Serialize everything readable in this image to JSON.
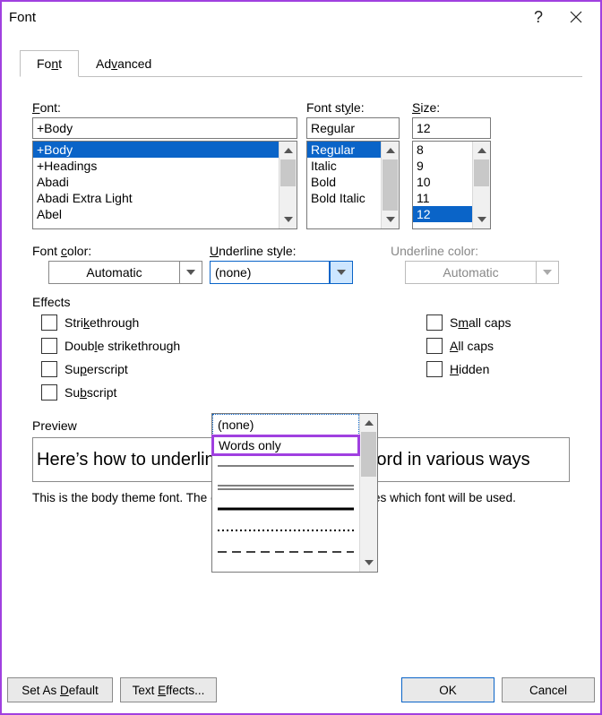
{
  "window": {
    "title": "Font"
  },
  "tabs": [
    {
      "label": "Font",
      "id": "font",
      "active": true,
      "hotkey": "F"
    },
    {
      "label": "Advanced",
      "id": "advanced",
      "active": false,
      "hotkey": "v"
    }
  ],
  "font": {
    "label": "Font:",
    "value": "+Body",
    "options": [
      "+Body",
      "+Headings",
      "Abadi",
      "Abadi Extra Light",
      "Abel"
    ],
    "selected": "+Body"
  },
  "font_style": {
    "label": "Font style:",
    "value": "Regular",
    "options": [
      "Regular",
      "Italic",
      "Bold",
      "Bold Italic"
    ],
    "selected": "Regular"
  },
  "size": {
    "label": "Size:",
    "value": "12",
    "options": [
      "8",
      "9",
      "10",
      "11",
      "12"
    ],
    "selected": "12"
  },
  "font_color": {
    "label": "Font color:",
    "value": "Automatic"
  },
  "underline_style": {
    "label": "Underline style:",
    "value": "(none)",
    "popup_open": true,
    "options": [
      "(none)",
      "Words only"
    ],
    "highlighted": "Words only"
  },
  "underline_color": {
    "label": "Underline color:",
    "value": "Automatic",
    "disabled": true
  },
  "effects": {
    "label": "Effects",
    "left": [
      {
        "id": "strike",
        "label": "Strikethrough",
        "checked": false,
        "hotkey": "k"
      },
      {
        "id": "dstrike",
        "label": "Double strikethrough",
        "checked": false,
        "hotkey": "l"
      },
      {
        "id": "super",
        "label": "Superscript",
        "checked": false,
        "hotkey": "p"
      },
      {
        "id": "sub",
        "label": "Subscript",
        "checked": false,
        "hotkey": "b"
      }
    ],
    "right": [
      {
        "id": "smallcaps",
        "label": "Small caps",
        "checked": false,
        "hotkey": "m"
      },
      {
        "id": "allcaps",
        "label": "All caps",
        "checked": false,
        "hotkey": "A"
      },
      {
        "id": "hidden",
        "label": "Hidden",
        "checked": false,
        "hotkey": "H"
      }
    ]
  },
  "preview": {
    "label": "Preview",
    "text": "Here’s how to underline text in Microsoft Word in various ways",
    "note": "This is the body theme font. The current document theme defines which font will be used."
  },
  "buttons": {
    "set_default": "Set As Default",
    "text_effects": "Text Effects...",
    "ok": "OK",
    "cancel": "Cancel"
  }
}
